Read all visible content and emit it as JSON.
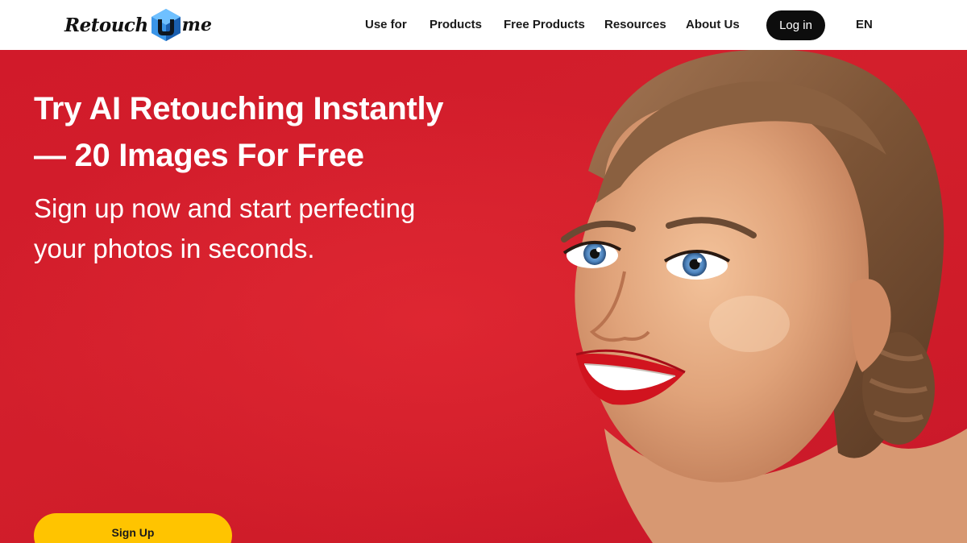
{
  "brand": {
    "name_part1": "Retouch",
    "name_part2": "me",
    "cube_letter": "u",
    "colors": {
      "cube_light": "#4aa6f0",
      "cube_dark": "#1a5fb0",
      "text": "#121212"
    }
  },
  "nav": {
    "items": [
      {
        "label": "Use for"
      },
      {
        "label": "Products"
      },
      {
        "label": "Free Products"
      },
      {
        "label": "Resources"
      },
      {
        "label": "About Us"
      }
    ],
    "login_label": "Log in",
    "language": "EN"
  },
  "hero": {
    "title_line1": "Try AI Retouching Instantly",
    "title_line2": "— 20 Images For Free",
    "subtitle_line1": "Sign up now and start perfecting",
    "subtitle_line2": "your photos in seconds.",
    "cta_label": "Sign Up",
    "image_icon": "smiling-woman-portrait",
    "colors": {
      "background": "#d31f2c",
      "cta": "#ffc400",
      "text": "#ffffff"
    }
  }
}
